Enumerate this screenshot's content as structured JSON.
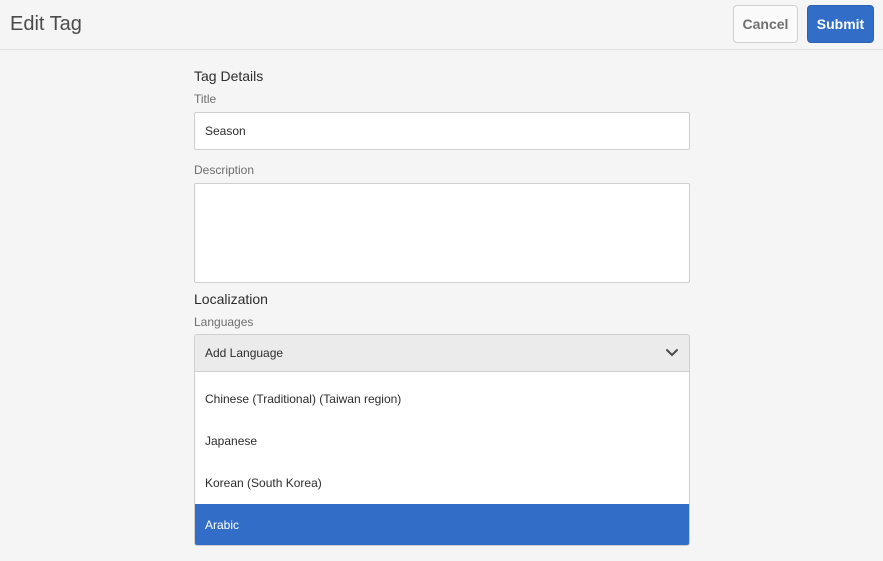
{
  "header": {
    "title": "Edit Tag",
    "cancel_label": "Cancel",
    "submit_label": "Submit"
  },
  "tag_details": {
    "heading": "Tag Details",
    "title_label": "Title",
    "title_value": "Season",
    "description_label": "Description",
    "description_value": ""
  },
  "localization": {
    "heading": "Localization",
    "languages_label": "Languages",
    "select_value": "Add Language",
    "options": [
      {
        "label": "Chinese (Traditional) (Taiwan region)",
        "selected": false
      },
      {
        "label": "Japanese",
        "selected": false
      },
      {
        "label": "Korean (South Korea)",
        "selected": false
      },
      {
        "label": "Arabic",
        "selected": true
      }
    ]
  },
  "colors": {
    "accent": "#326ec8",
    "background": "#f5f5f5"
  },
  "icons": {
    "dropdown": "chevron-down-icon"
  }
}
